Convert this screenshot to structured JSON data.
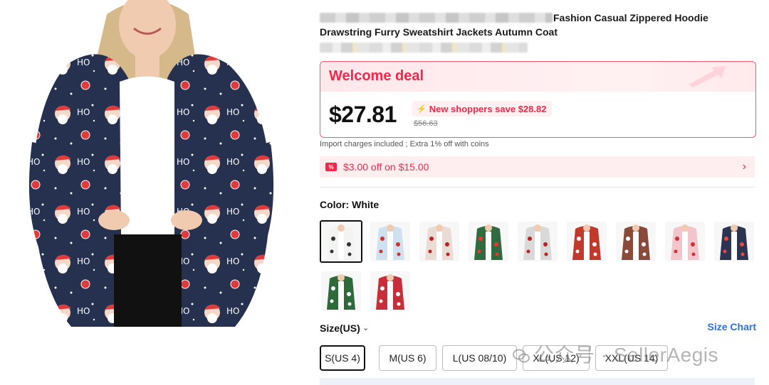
{
  "product": {
    "title_line1": "Fashion Casual Zippered Hoodie",
    "title_line2": "Drawstring Furry Sweatshirt Jackets Autumn Coat",
    "image_icon": "product-photo"
  },
  "deal": {
    "title": "Welcome deal",
    "price": "$27.81",
    "save_text": "New shoppers save $28.82",
    "old_price": "$56.63"
  },
  "import_note": "Import charges included ; Extra 1% off with coins",
  "coupon": {
    "icon": "coupon-icon",
    "icon_text": "%",
    "text": "$3.00 off on $15.00",
    "chevron": "›"
  },
  "color": {
    "label": "Color: White",
    "swatches": [
      {
        "name": "white",
        "base": "#f2f4f2",
        "print": "#333"
      },
      {
        "name": "light-blue",
        "base": "#cfe0ee",
        "print": "#c33"
      },
      {
        "name": "beige-red",
        "base": "#eadbd5",
        "print": "#b22"
      },
      {
        "name": "green",
        "base": "#2f6b3f",
        "print": "#e33"
      },
      {
        "name": "gray",
        "base": "#d9d9d9",
        "print": "#b22"
      },
      {
        "name": "red",
        "base": "#c0392b",
        "print": "#fff"
      },
      {
        "name": "brown",
        "base": "#8a4a3a",
        "print": "#fff"
      },
      {
        "name": "pink",
        "base": "#f2c4cc",
        "print": "#c33"
      },
      {
        "name": "navy",
        "base": "#2b3552",
        "print": "#e44"
      },
      {
        "name": "dark-green",
        "base": "#2d6a3a",
        "print": "#fff"
      },
      {
        "name": "crimson",
        "base": "#c72e3a",
        "print": "#fff"
      }
    ]
  },
  "size": {
    "label": "Size(US)",
    "chevron": "⌄",
    "chart_link": "Size Chart",
    "options": [
      "S(US 4)",
      "M(US 6)",
      "L(US 08/10)",
      "XL(US 12)",
      "XXL(US 14)"
    ]
  },
  "watermark": "公众号 · SellerAegis",
  "colors": {
    "accent": "#f5264a",
    "link": "#2f6fdb",
    "deal_border": "#f5566b"
  }
}
